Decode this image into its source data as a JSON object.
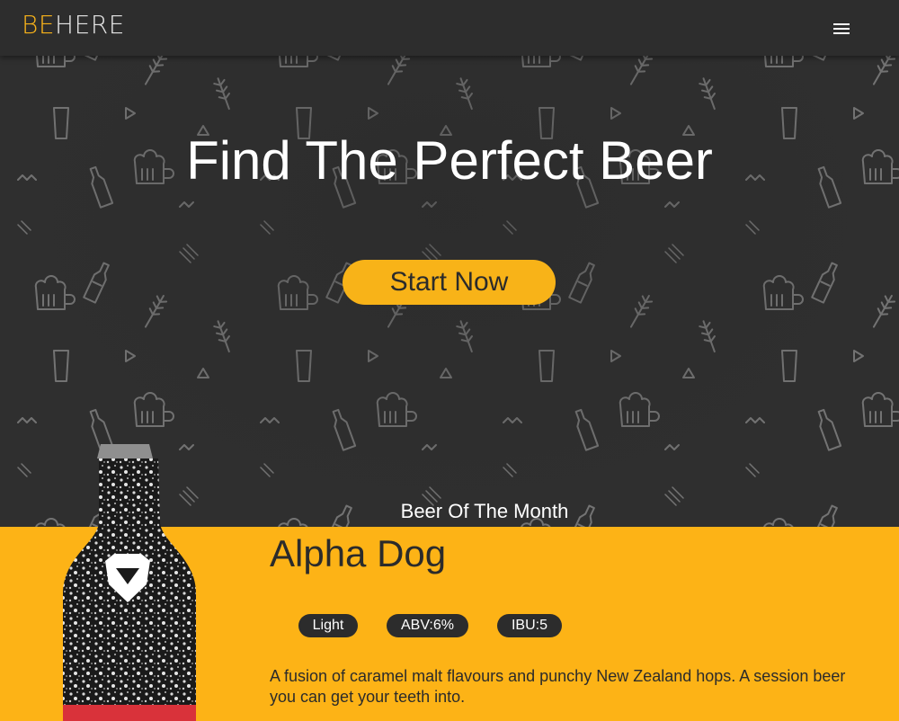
{
  "header": {
    "logo_part1": "BE",
    "logo_part2": "HER",
    "logo_part3": "E",
    "menu_icon": "hamburger-menu-icon"
  },
  "hero": {
    "title": "Find The Perfect Beer",
    "cta_label": "Start Now",
    "background_icons": [
      "beer-mug-icon",
      "beer-bottle-icon",
      "wheat-icon",
      "pint-glass-icon",
      "triangle-icon",
      "zigzag-icon"
    ]
  },
  "beer_of_month": {
    "section_label": "Beer Of The Month",
    "name": "Alpha Dog",
    "tags": [
      "Light",
      "ABV:6%",
      "IBU:5"
    ],
    "description": "A fusion of caramel malt flavours and punchy New Zealand hops. A session beer you can get your teeth into.",
    "image": "beer-bottle-image"
  },
  "colors": {
    "accent": "#fdb316",
    "dark": "#2d2d2d",
    "text_light": "#ffffff"
  }
}
